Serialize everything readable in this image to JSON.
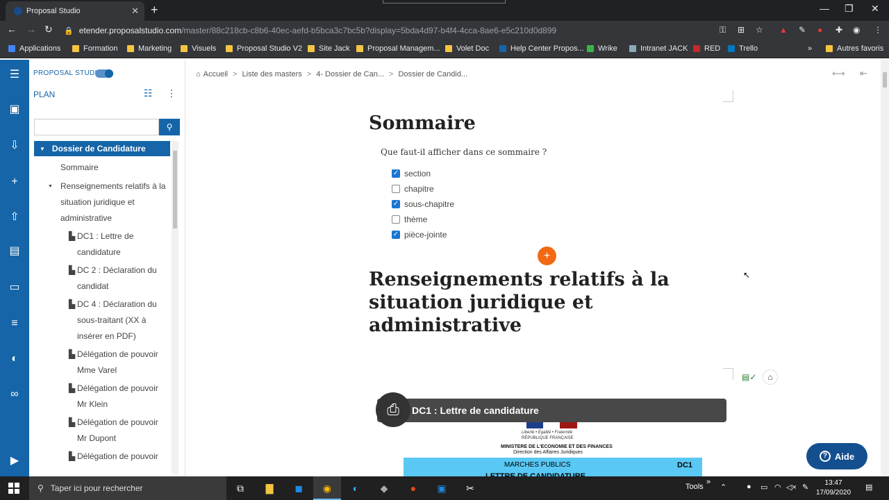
{
  "browser": {
    "tab_title": "Proposal Studio",
    "url_host": "etender.proposalstudio.com",
    "url_path": "/master/88c218cb-c8b6-40ec-aefd-b5bca3c7bc5b?display=5bda4d97-b4f4-4cca-8ae6-e5c210d0d899",
    "bookmarks": [
      "Applications",
      "Formation",
      "Marketing",
      "Visuels",
      "Proposal Studio V2",
      "Site Jack",
      "Proposal Managem...",
      "Volet Doc",
      "Help Center Propos...",
      "Wrike",
      "Intranet JACK",
      "RED",
      "Trello",
      "Autres favoris"
    ]
  },
  "sidebar": {
    "brand": "PROPOSAL STUDIO",
    "plan_label": "PLAN",
    "search_placeholder": "",
    "root": "Dossier de Candidature",
    "items": [
      {
        "label": "Sommaire"
      },
      {
        "label": "Renseignements relatifs à la situation juridique et administrative"
      },
      {
        "label": "DC1 : Lettre de candidature"
      },
      {
        "label": "DC 2 : Déclaration du candidat"
      },
      {
        "label": "DC 4 : Déclaration du sous-traitant (XX à insérer en PDF)"
      },
      {
        "label": "Délégation de pouvoir Mme Varel"
      },
      {
        "label": "Délégation de pouvoir Mr Klein"
      },
      {
        "label": "Délégation de pouvoir Mr Dupont"
      },
      {
        "label": "Délégation de pouvoir"
      }
    ]
  },
  "breadcrumb": [
    "Accueil",
    "Liste des masters",
    "4- Dossier de Can...",
    "Dossier de Candid..."
  ],
  "content": {
    "title": "Sommaire",
    "question": "Que faut-il afficher dans ce sommaire ?",
    "options": [
      {
        "label": "section",
        "checked": true
      },
      {
        "label": "chapitre",
        "checked": false
      },
      {
        "label": "sous-chapitre",
        "checked": true
      },
      {
        "label": "thème",
        "checked": false
      },
      {
        "label": "pièce-jointe",
        "checked": true
      }
    ],
    "section_title": "Renseignements relatifs à la situation juridique et administrative",
    "attachment_title": "DC1 : Lettre de candidature",
    "doc_preview": {
      "line1": "Liberté • Égalité • Fraternité",
      "line2": "RÉPUBLIQUE FRANÇAISE",
      "line3": "MINISTERE DE L'ECONOMIE ET DES FINANCES",
      "line4": "Direction des Affaires Juridiques",
      "band1": "MARCHES PUBLICS",
      "band_code": "DC1",
      "band2": "LETTRE DE CANDIDATURE"
    },
    "help_label": "Aide"
  },
  "taskbar": {
    "search_placeholder": "Taper ici pour rechercher",
    "tools_label": "Tools",
    "time": "13:47",
    "date": "17/09/2020"
  },
  "colors": {
    "accent": "#1565a8",
    "orange": "#f16a13",
    "checkbox": "#1976d2"
  }
}
